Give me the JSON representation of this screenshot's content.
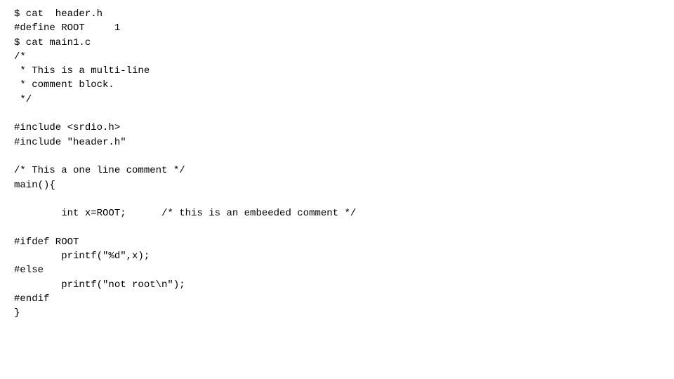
{
  "code": {
    "lines": [
      {
        "id": "l1",
        "text": "$ cat  header.h"
      },
      {
        "id": "l2",
        "text": "#define ROOT     1"
      },
      {
        "id": "l3",
        "text": "$ cat main1.c"
      },
      {
        "id": "l4",
        "text": "/*"
      },
      {
        "id": "l5",
        "text": " * This is a multi-line"
      },
      {
        "id": "l6",
        "text": " * comment block."
      },
      {
        "id": "l7",
        "text": " */"
      },
      {
        "id": "l8",
        "text": ""
      },
      {
        "id": "l9",
        "text": "#include <srdio.h>"
      },
      {
        "id": "l10",
        "text": "#include \"header.h\""
      },
      {
        "id": "l11",
        "text": ""
      },
      {
        "id": "l12",
        "text": "/* This a one line comment */"
      },
      {
        "id": "l13",
        "text": "main(){"
      },
      {
        "id": "l14",
        "text": ""
      },
      {
        "id": "l15",
        "text": "        int x=ROOT;      /* this is an embeeded comment */"
      },
      {
        "id": "l16",
        "text": ""
      },
      {
        "id": "l17",
        "text": "#ifdef ROOT"
      },
      {
        "id": "l18",
        "text": "        printf(\"%d\",x);"
      },
      {
        "id": "l19",
        "text": "#else"
      },
      {
        "id": "l20",
        "text": "        printf(\"not root\\n\");"
      },
      {
        "id": "l21",
        "text": "#endif"
      },
      {
        "id": "l22",
        "text": "}"
      }
    ]
  }
}
